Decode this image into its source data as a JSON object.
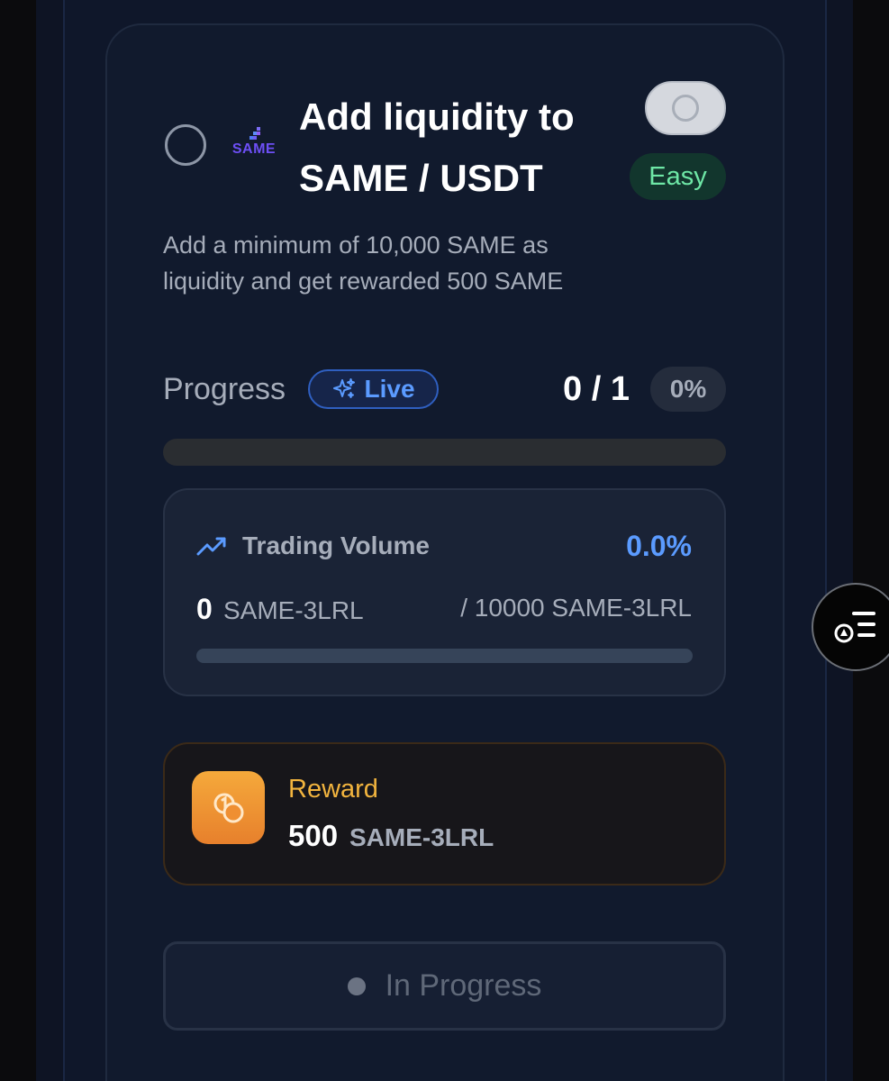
{
  "task": {
    "brand_logo_text": "SAME",
    "title_line1": "Add liquidity to",
    "title_line2": "SAME / USDT",
    "difficulty": "Easy",
    "description": "Add a minimum of 10,000 SAME as liquidity and get rewarded 500 SAME",
    "enabled": false
  },
  "progress": {
    "label": "Progress",
    "live_label": "Live",
    "count_text": "0 / 1",
    "percent_text": "0%",
    "percent_value": 0
  },
  "trading_volume": {
    "title": "Trading Volume",
    "percent_text": "0.0%",
    "percent_value": 0,
    "current_value": "0",
    "current_unit": "SAME-3LRL",
    "target_text": "/ 10000 SAME-3LRL"
  },
  "reward": {
    "label": "Reward",
    "amount": "500",
    "unit": "SAME-3LRL"
  },
  "status_button": {
    "label": "In Progress"
  },
  "colors": {
    "accent_blue": "#5b9bff",
    "easy_green": "#6ee7a6",
    "reward_gold": "#f2b43e",
    "reward_icon_orange": "#e7802c",
    "brand_purple": "#6d4ff6"
  },
  "icons": {
    "live": "sparkles-icon",
    "volume": "trending-up-icon",
    "reward": "coins-icon",
    "fab": "task-list-icon"
  }
}
